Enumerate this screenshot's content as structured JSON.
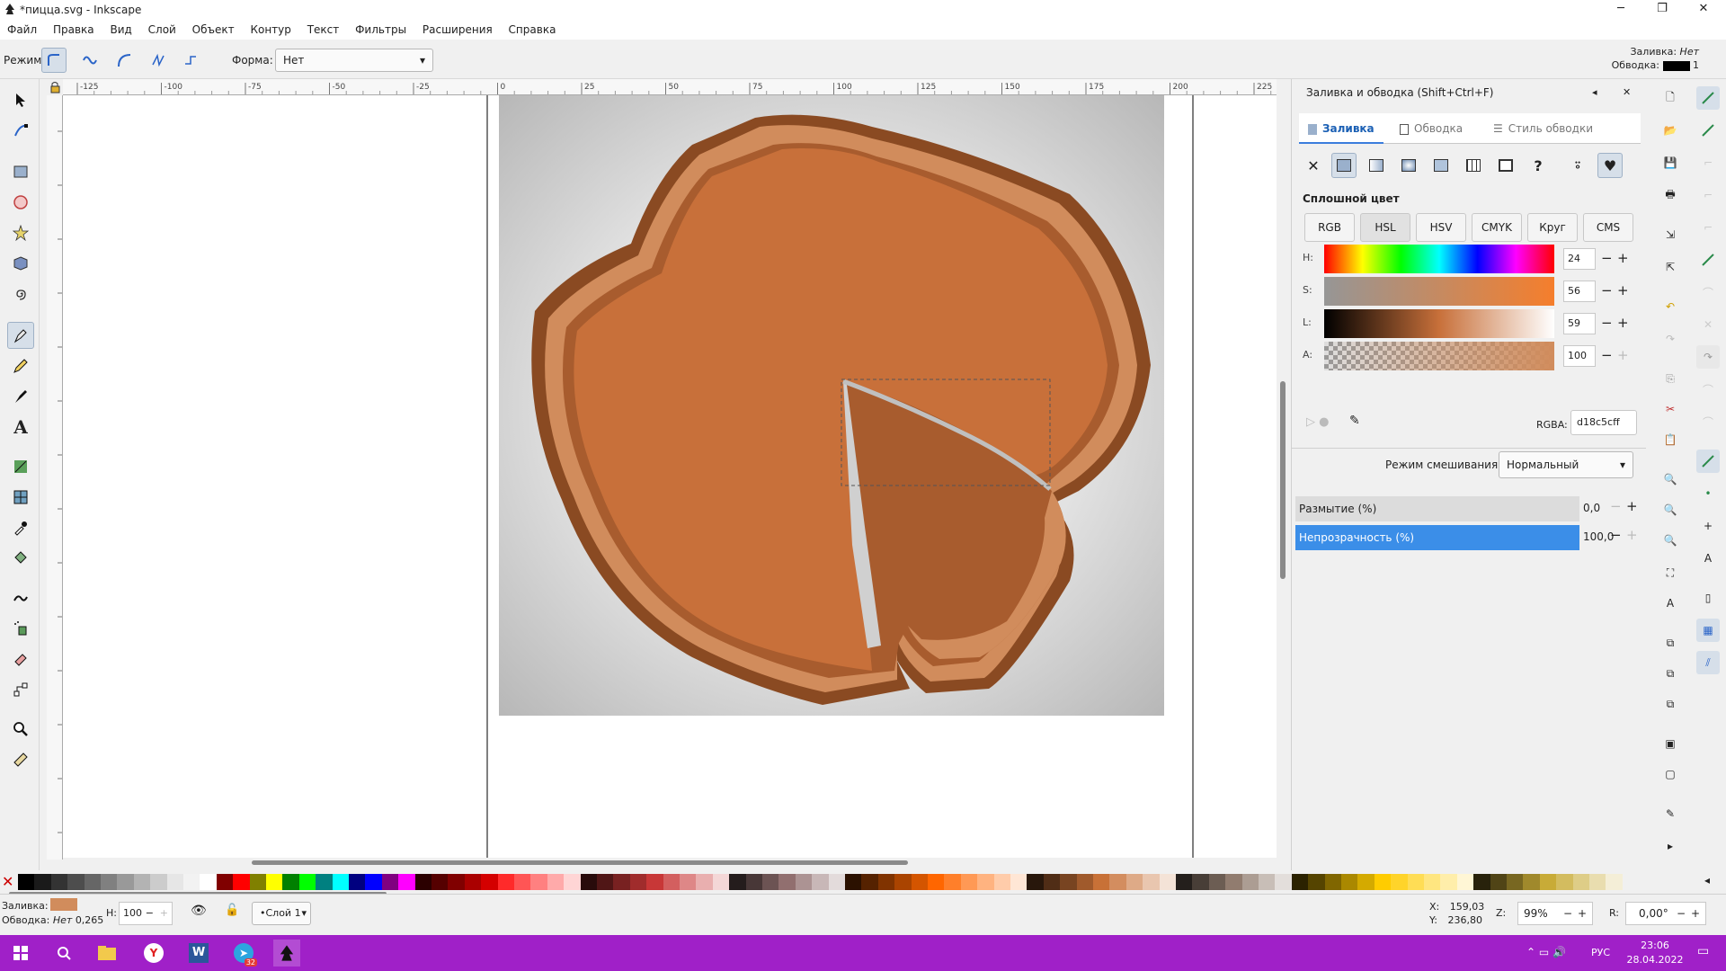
{
  "window": {
    "title": "*пицца.svg - Inkscape"
  },
  "menu": [
    "Файл",
    "Правка",
    "Вид",
    "Слой",
    "Объект",
    "Контур",
    "Текст",
    "Фильтры",
    "Расширения",
    "Справка"
  ],
  "toolbar": {
    "mode_label": "Режим:",
    "shape_label": "Форма:",
    "shape_value": "Нет"
  },
  "fill_indicator": {
    "fill_label": "Заливка:",
    "fill_value": "Нет",
    "stroke_label": "Обводка:",
    "stroke_value": "1"
  },
  "ruler": {
    "ticks": [
      "-125",
      "-100",
      "-75",
      "-50",
      "-25",
      "0",
      "25",
      "50",
      "75",
      "100",
      "125",
      "150",
      "175",
      "200",
      "225"
    ]
  },
  "panel": {
    "title": "Заливка и обводка (Shift+Ctrl+F)",
    "tabs": [
      "Заливка",
      "Обводка",
      "Стиль обводки"
    ],
    "flat_color_label": "Сплошной цвет",
    "modes": [
      "RGB",
      "HSL",
      "HSV",
      "CMYK",
      "Круг",
      "CMS"
    ],
    "sliders": [
      {
        "label": "H:",
        "value": "24"
      },
      {
        "label": "S:",
        "value": "56"
      },
      {
        "label": "L:",
        "value": "59"
      },
      {
        "label": "A:",
        "value": "100"
      }
    ],
    "rgba_label": "RGBA:",
    "rgba_value": "d18c5cff",
    "blend_label": "Режим смешивания:",
    "blend_value": "Нормальный",
    "blur_label": "Размытие (%)",
    "blur_value": "0,0",
    "opacity_label": "Непрозрачность (%)",
    "opacity_value": "100,0"
  },
  "status": {
    "fill_label": "Заливка:",
    "stroke_label": "Обводка:",
    "stroke_value": "Нет",
    "stroke_width": "0,265",
    "h_label": "Н:",
    "h_value": "100",
    "layer": "•Слой 1",
    "x_label": "X:",
    "x_value": "159,03",
    "y_label": "Y:",
    "y_value": "236,80",
    "zoom_label": "Z:",
    "zoom_value": "99%",
    "rot_label": "R:",
    "rot_value": "0,00°"
  },
  "taskbar": {
    "lang": "РУС",
    "time": "23:06",
    "date": "28.04.2022",
    "badge": "32"
  },
  "colors": {
    "accent": "#a020c8",
    "pizza_fill": "#c8703a",
    "crust_light": "#d18c5c",
    "crust_dark": "#8a4a22",
    "slice": "#a85c2e",
    "selection_blue": "#3b8ee8"
  }
}
